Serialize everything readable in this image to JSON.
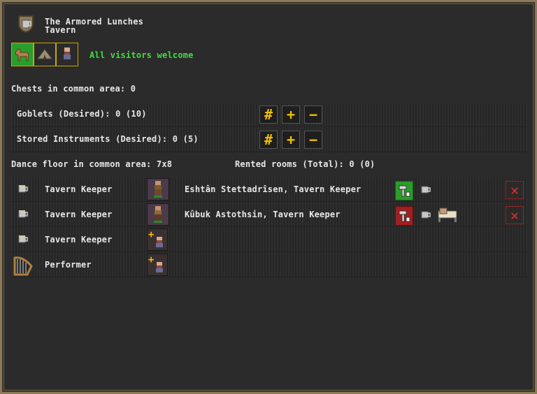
{
  "header": {
    "name": "The Armored Lunches",
    "type": "Tavern",
    "visitor_status": "All visitors welcome"
  },
  "chests_label": "Chests in common area: 0",
  "goblets": {
    "label": "Goblets (Desired): 0 (10)",
    "set_label": "#",
    "plus_label": "+",
    "minus_label": "−"
  },
  "instruments": {
    "label": "Stored Instruments (Desired): 0 (5)",
    "set_label": "#",
    "plus_label": "+",
    "minus_label": "−"
  },
  "dance_floor_label": "Dance floor in common area: 7x8",
  "rented_rooms_label": "Rented rooms (Total): 0 (0)",
  "positions": [
    {
      "role": "Tavern Keeper",
      "assignee": "Eshtân Stettadrîsen, Tavern Keeper",
      "labor_status": "enabled",
      "has_remove": true
    },
    {
      "role": "Tavern Keeper",
      "assignee": "Kûbuk Astothsin, Tavern Keeper",
      "labor_status": "disabled",
      "has_remove": true
    },
    {
      "role": "Tavern Keeper",
      "assignee": "",
      "labor_status": "",
      "has_remove": false
    },
    {
      "role": "Performer",
      "assignee": "",
      "labor_status": "",
      "has_remove": false
    }
  ],
  "colors": {
    "visitor_text": "#3ee03e",
    "accent_gold": "#f0c000",
    "remove_red": "#e03030",
    "active_green": "#2a9e2a",
    "labor_disabled_red": "#a02020"
  }
}
